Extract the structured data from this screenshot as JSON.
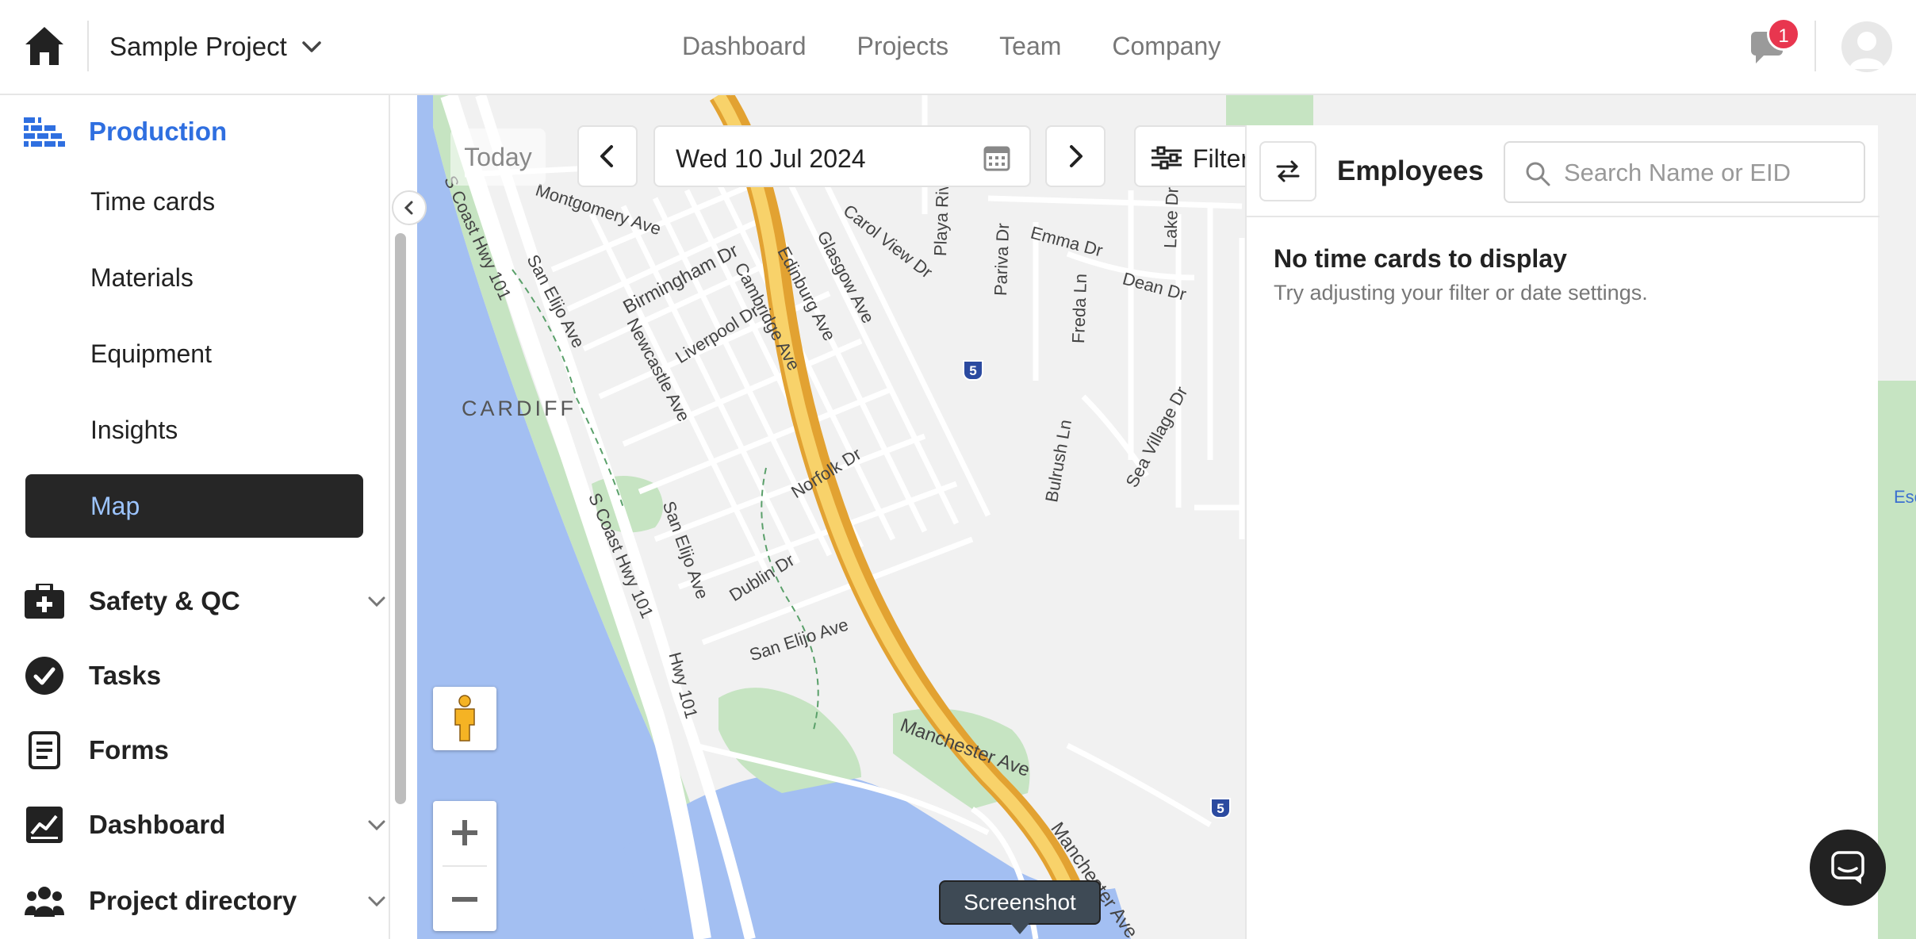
{
  "header": {
    "project_name": "Sample Project",
    "nav": [
      "Dashboard",
      "Projects",
      "Team",
      "Company"
    ],
    "notification_count": "1"
  },
  "sidebar": {
    "production": {
      "label": "Production",
      "items": [
        "Time cards",
        "Materials",
        "Equipment",
        "Insights",
        "Map"
      ],
      "active": "Map"
    },
    "sections": [
      {
        "label": "Safety & QC",
        "icon": "medkit-icon",
        "expandable": true
      },
      {
        "label": "Tasks",
        "icon": "check-circle-icon",
        "expandable": false
      },
      {
        "label": "Forms",
        "icon": "document-icon",
        "expandable": false
      },
      {
        "label": "Dashboard",
        "icon": "chart-icon",
        "expandable": true
      },
      {
        "label": "Project directory",
        "icon": "people-icon",
        "expandable": true
      }
    ]
  },
  "map_toolbar": {
    "today_label": "Today",
    "date_value": "Wed 10 Jul 2024",
    "filters_label": "Filters"
  },
  "employees_panel": {
    "title": "Employees",
    "search_placeholder": "Search Name or EID",
    "empty_title": "No time cards to display",
    "empty_subtitle": "Try adjusting your filter or date settings."
  },
  "map": {
    "labels": {
      "cardiff": "CARDIFF",
      "s_coast_hwy": "S Coast Hwy 101",
      "s_coast_hwy2": "S Coast Hwy 101",
      "san_elijo": "San Elijo Ave",
      "san_elijo2": "San Elijo Ave",
      "san_elijo3": "San Elijo Ave",
      "hwy101": "Hwy 101",
      "montgomery": "Montgomery Ave",
      "birmingham": "Birmingham Dr",
      "newcastle": "Newcastle Ave",
      "liverpool": "Liverpool Dr",
      "cambridge": "Cambridge Ave",
      "edinburg": "Edinburg Ave",
      "glasgow": "Glasgow Ave",
      "carol_view": "Carol View Dr",
      "norfolk": "Norfolk Dr",
      "dublin": "Dublin Dr",
      "manchester": "Manchester Ave",
      "manchester2": "Manchester Ave",
      "emma": "Emma Dr",
      "dean": "Dean Dr",
      "playa_riviera": "Playa Riviera Dr",
      "pariva": "Pariva Dr",
      "freda": "Freda Ln",
      "lake": "Lake Dr",
      "bulrush": "Bulrush Ln",
      "sea_village": "Sea Village Dr",
      "i5_a": "5",
      "i5_b": "5",
      "edge_right": "Esc"
    }
  },
  "tooltip": "Screenshot",
  "colors": {
    "accent_blue": "#2f6fe0",
    "active_bg": "#262626",
    "active_text": "#9cc4ff",
    "water": "#a3bff2",
    "park": "#c6e4c2",
    "highway": "#f4b93b",
    "badge": "#e8364f"
  }
}
